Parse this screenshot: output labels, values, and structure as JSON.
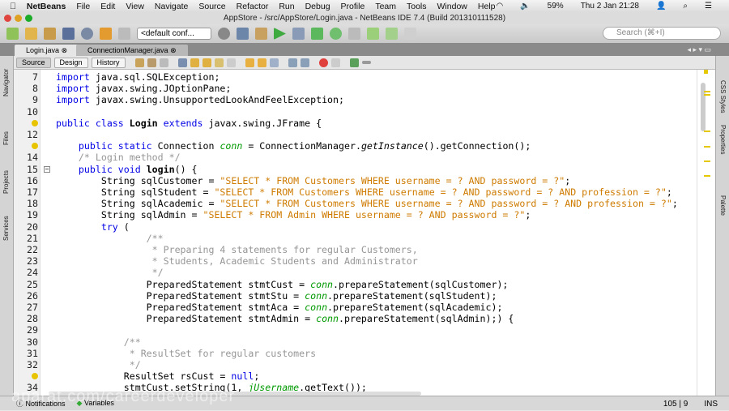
{
  "menubar": {
    "app": "NetBeans",
    "items": [
      "File",
      "Edit",
      "View",
      "Navigate",
      "Source",
      "Refactor",
      "Run",
      "Debug",
      "Profile",
      "Team",
      "Tools",
      "Window",
      "Help"
    ],
    "battery": "59%",
    "clock": "Thu 2 Jan  21:28"
  },
  "window": {
    "title": "AppStore - /src/AppStore/Login.java - NetBeans IDE 7.4 (Build 201310111528)"
  },
  "toolbar": {
    "config": "<default conf...",
    "search_placeholder": "Search (⌘+I)"
  },
  "tabs": [
    {
      "label": "Login.java",
      "active": true
    },
    {
      "label": "ConnectionManager.java",
      "active": false
    }
  ],
  "editor_toolbar": {
    "source": "Source",
    "design": "Design",
    "history": "History"
  },
  "left_panels": [
    "Navigator",
    "Files",
    "Projects",
    "Services"
  ],
  "right_panels": [
    "CSS Styles",
    "Properties",
    "Palette"
  ],
  "code": [
    {
      "n": "7",
      "t": [
        [
          "kw",
          "import"
        ],
        [
          "",
          "java.sql.SQLException;"
        ]
      ]
    },
    {
      "n": "8",
      "t": [
        [
          "kw",
          "import"
        ],
        [
          "",
          "javax.swing.JOptionPane;"
        ]
      ]
    },
    {
      "n": "9",
      "t": [
        [
          "kw",
          "import"
        ],
        [
          "",
          "javax.swing.UnsupportedLookAndFeelException;"
        ]
      ]
    },
    {
      "n": "10",
      "t": []
    },
    {
      "n": "",
      "bulb": true,
      "t": [
        [
          "kw",
          "public class "
        ],
        [
          "b",
          "Login"
        ],
        [
          "kw",
          " extends"
        ],
        [
          "",
          " javax.swing.JFrame {"
        ]
      ]
    },
    {
      "n": "12",
      "t": []
    },
    {
      "n": "",
      "bulb": true,
      "t": [
        [
          "",
          "    "
        ],
        [
          "kw",
          "public static"
        ],
        [
          "",
          " Connection "
        ],
        [
          "fld",
          "conn"
        ],
        [
          "",
          " = ConnectionManager."
        ],
        [
          "it",
          "getInstance"
        ],
        [
          "",
          "().getConnection();"
        ]
      ]
    },
    {
      "n": "14",
      "t": [
        [
          "cm",
          "    /* Login method */"
        ]
      ]
    },
    {
      "n": "15",
      "fold": true,
      "t": [
        [
          "",
          "    "
        ],
        [
          "kw",
          "public void "
        ],
        [
          "b",
          "login"
        ],
        [
          "",
          "() {"
        ]
      ]
    },
    {
      "n": "16",
      "t": [
        [
          "",
          "        String sqlCustomer = "
        ],
        [
          "str",
          "\"SELECT * FROM Customers WHERE username = ? AND password = ?\""
        ],
        [
          "",
          ";"
        ]
      ]
    },
    {
      "n": "17",
      "t": [
        [
          "",
          "        String sqlStudent = "
        ],
        [
          "str",
          "\"SELECT * FROM Customers WHERE username = ? AND password = ? AND profession = ?\""
        ],
        [
          "",
          ";"
        ]
      ]
    },
    {
      "n": "18",
      "t": [
        [
          "",
          "        String sqlAcademic = "
        ],
        [
          "str",
          "\"SELECT * FROM Customers WHERE username = ? AND password = ? AND profession = ?\""
        ],
        [
          "",
          ";"
        ]
      ]
    },
    {
      "n": "19",
      "t": [
        [
          "",
          "        String sqlAdmin = "
        ],
        [
          "str",
          "\"SELECT * FROM Admin WHERE username = ? AND password = ?\""
        ],
        [
          "",
          ";"
        ]
      ]
    },
    {
      "n": "20",
      "t": [
        [
          "kw",
          "        try"
        ],
        [
          "",
          " ("
        ]
      ]
    },
    {
      "n": "21",
      "t": [
        [
          "cm",
          "                /**"
        ]
      ]
    },
    {
      "n": "22",
      "t": [
        [
          "cm",
          "                 * Preparing 4 statements for regular Customers,"
        ]
      ]
    },
    {
      "n": "23",
      "t": [
        [
          "cm",
          "                 * Students, Academic Students and Administrator"
        ]
      ]
    },
    {
      "n": "24",
      "t": [
        [
          "cm",
          "                 */"
        ]
      ]
    },
    {
      "n": "25",
      "t": [
        [
          "",
          "                PreparedStatement stmtCust = "
        ],
        [
          "fld",
          "conn"
        ],
        [
          "",
          ".prepareStatement(sqlCustomer);"
        ]
      ]
    },
    {
      "n": "26",
      "t": [
        [
          "",
          "                PreparedStatement stmtStu = "
        ],
        [
          "fld",
          "conn"
        ],
        [
          "",
          ".prepareStatement(sqlStudent);"
        ]
      ]
    },
    {
      "n": "27",
      "t": [
        [
          "",
          "                PreparedStatement stmtAca = "
        ],
        [
          "fld",
          "conn"
        ],
        [
          "",
          ".prepareStatement(sqlAcademic);"
        ]
      ]
    },
    {
      "n": "28",
      "t": [
        [
          "",
          "                PreparedStatement stmtAdmin = "
        ],
        [
          "fld",
          "conn"
        ],
        [
          "",
          ".prepareStatement(sqlAdmin);) {"
        ]
      ]
    },
    {
      "n": "29",
      "t": []
    },
    {
      "n": "30",
      "t": [
        [
          "cm",
          "            /**"
        ]
      ]
    },
    {
      "n": "31",
      "t": [
        [
          "cm",
          "             * ResultSet for regular customers"
        ]
      ]
    },
    {
      "n": "32",
      "t": [
        [
          "cm",
          "             */"
        ]
      ]
    },
    {
      "n": "",
      "bulb": true,
      "t": [
        [
          "",
          "            ResultSet rsCust = "
        ],
        [
          "kw",
          "null"
        ],
        [
          "",
          ";"
        ]
      ]
    },
    {
      "n": "34",
      "t": [
        [
          "",
          "            stmtCust.setString(1, "
        ],
        [
          "fld",
          "jUsername"
        ],
        [
          "",
          ".getText());"
        ]
      ]
    }
  ],
  "status": {
    "notifications": "Notifications",
    "variables": "Variables",
    "position": "105 | 9",
    "mode": "INS"
  },
  "watermark": "aparat.com/careerdeveloper"
}
